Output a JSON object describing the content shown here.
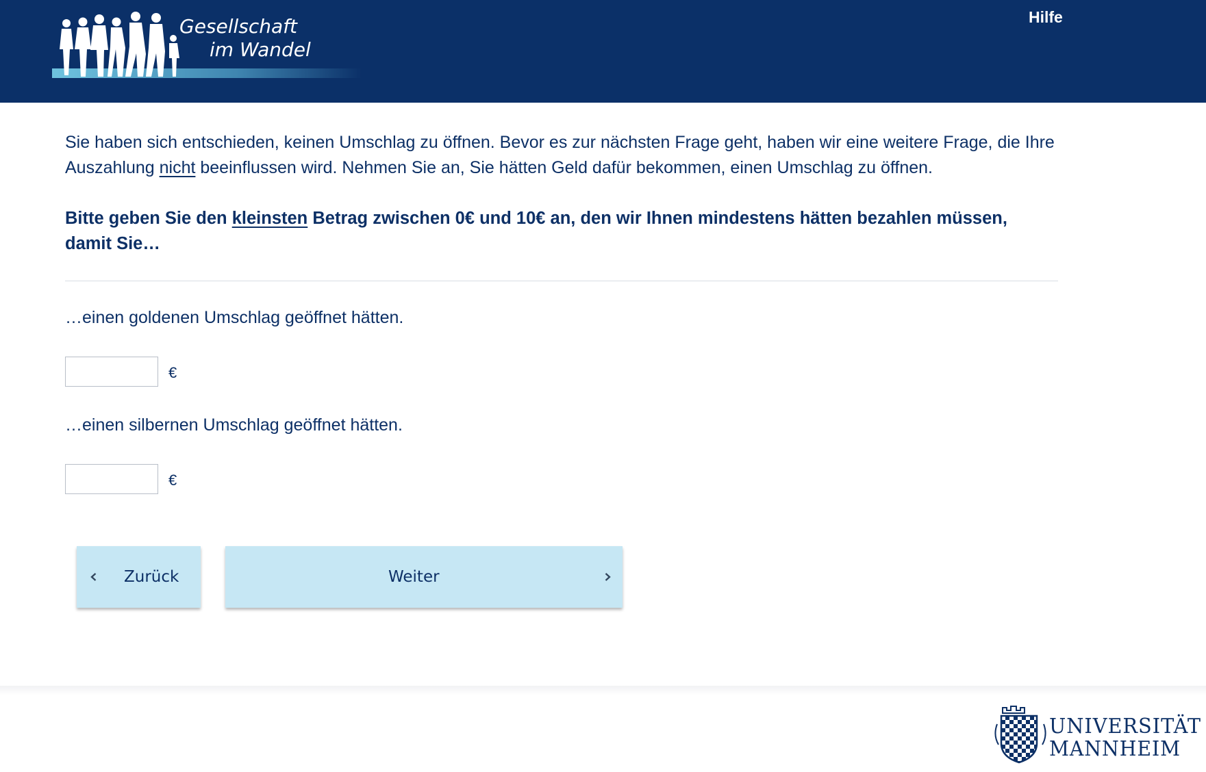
{
  "header": {
    "logo_text": "Gesellschaft im Wandel",
    "help_label": "Hilfe"
  },
  "question": {
    "intro_part1": "Sie haben sich entschieden, keinen Umschlag zu öffnen. Bevor es zur nächsten Frage geht, haben wir eine weitere Frage, die Ihre Auszahlung ",
    "intro_underlined": "nicht",
    "intro_part2": " beeinflussen wird. Nehmen Sie an, Sie hätten Geld dafür bekommen, einen Umschlag zu öffnen.",
    "instruction_part1": "Bitte geben Sie den ",
    "instruction_underlined": "kleinsten",
    "instruction_part2": " Betrag zwischen 0€ und 10€ an, den wir Ihnen mindestens hätten bezahlen müssen, damit Sie…"
  },
  "items": [
    {
      "label": "…einen goldenen Umschlag geöffnet hätten.",
      "value": "",
      "unit": "€"
    },
    {
      "label": "…einen silbernen Umschlag geöffnet hätten.",
      "value": "",
      "unit": "€"
    }
  ],
  "nav": {
    "back_label": "Zurück",
    "next_label": "Weiter"
  },
  "footer": {
    "university_logo_text": "UNIVERSITÄT MANNHEIM"
  },
  "colors": {
    "header_bg": "#0b3068",
    "text": "#0d3066",
    "button_bg": "#c6e7f4"
  },
  "icons": {
    "back": "chevron-left-icon",
    "next": "chevron-right-icon",
    "crest": "crest-icon",
    "people": "people-silhouette-icon"
  }
}
